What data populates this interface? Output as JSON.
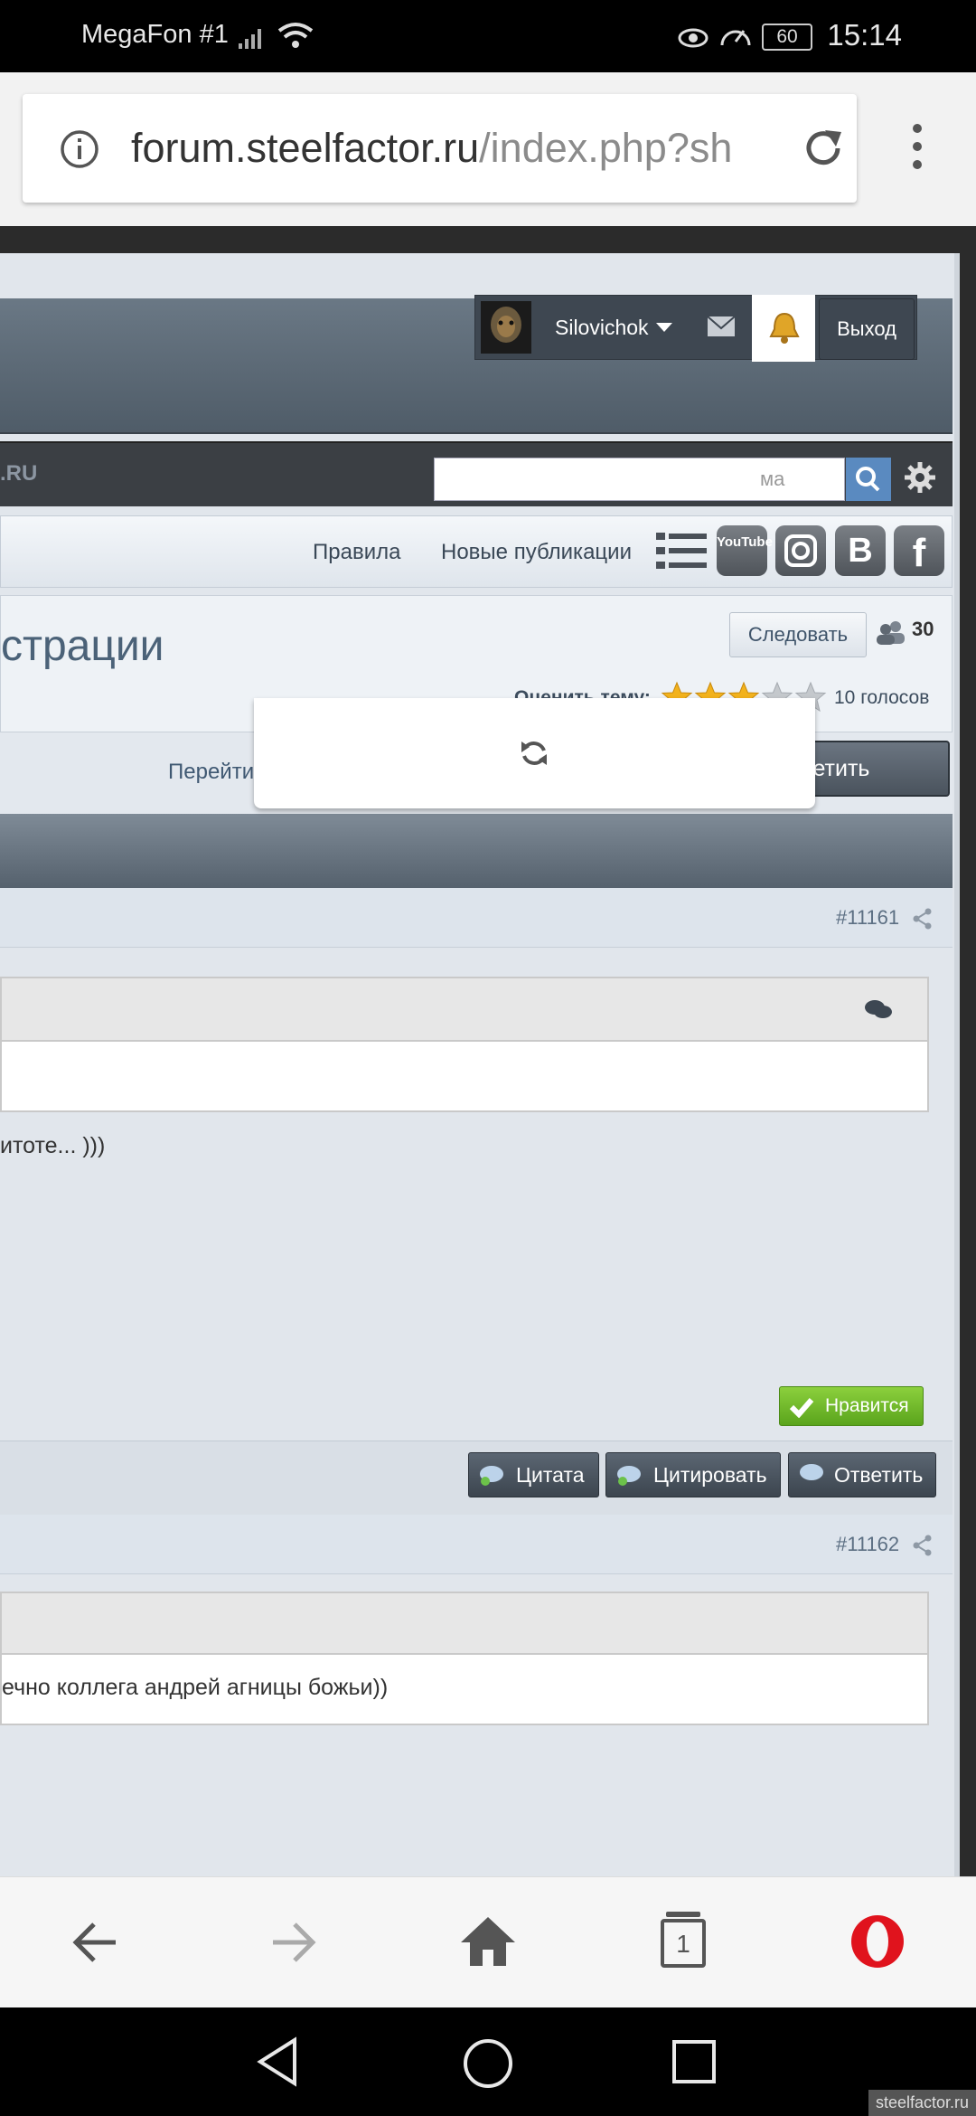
{
  "status_bar": {
    "carrier": "MegaFon #1",
    "battery": "60",
    "time": "15:14"
  },
  "browser": {
    "url_domain": "forum.steelfactor.ru",
    "url_path": "/index.php?sh",
    "tab_count": "1"
  },
  "user_nav": {
    "username": "Silovichok",
    "logout_label": "Выход"
  },
  "dark_bar": {
    "site_name": ".RU",
    "search_placeholder": "ма"
  },
  "link_bar": {
    "rules": "Правила",
    "new_posts": "Новые публикации",
    "socials": [
      "YouTube",
      "Instagram",
      "B",
      "f"
    ]
  },
  "thread": {
    "title_fragment": "страции",
    "follow_label": "Следовать",
    "follow_count": "30",
    "rate_label": "Оценить тему:",
    "rating": 3,
    "rating_max": 5,
    "votes": "10 голосов"
  },
  "actions": {
    "first_unread": "Перейти к первому не прочитанному сообщению",
    "reply": "Ответить"
  },
  "post1": {
    "number": "#11161",
    "text": "итоте... )))",
    "like_label": "Нравится",
    "quote_label": "Цитата",
    "cite_label": "Цитировать",
    "reply_label": "Ответить"
  },
  "post2": {
    "number": "#11162",
    "quote_text": "ечно коллега андрей агницы божьи))"
  },
  "watermark": "steelfactor.ru",
  "colors": {
    "accent_blue": "#5a8ac0",
    "like_green": "#6cb82a",
    "opera_red": "#e0131d"
  }
}
